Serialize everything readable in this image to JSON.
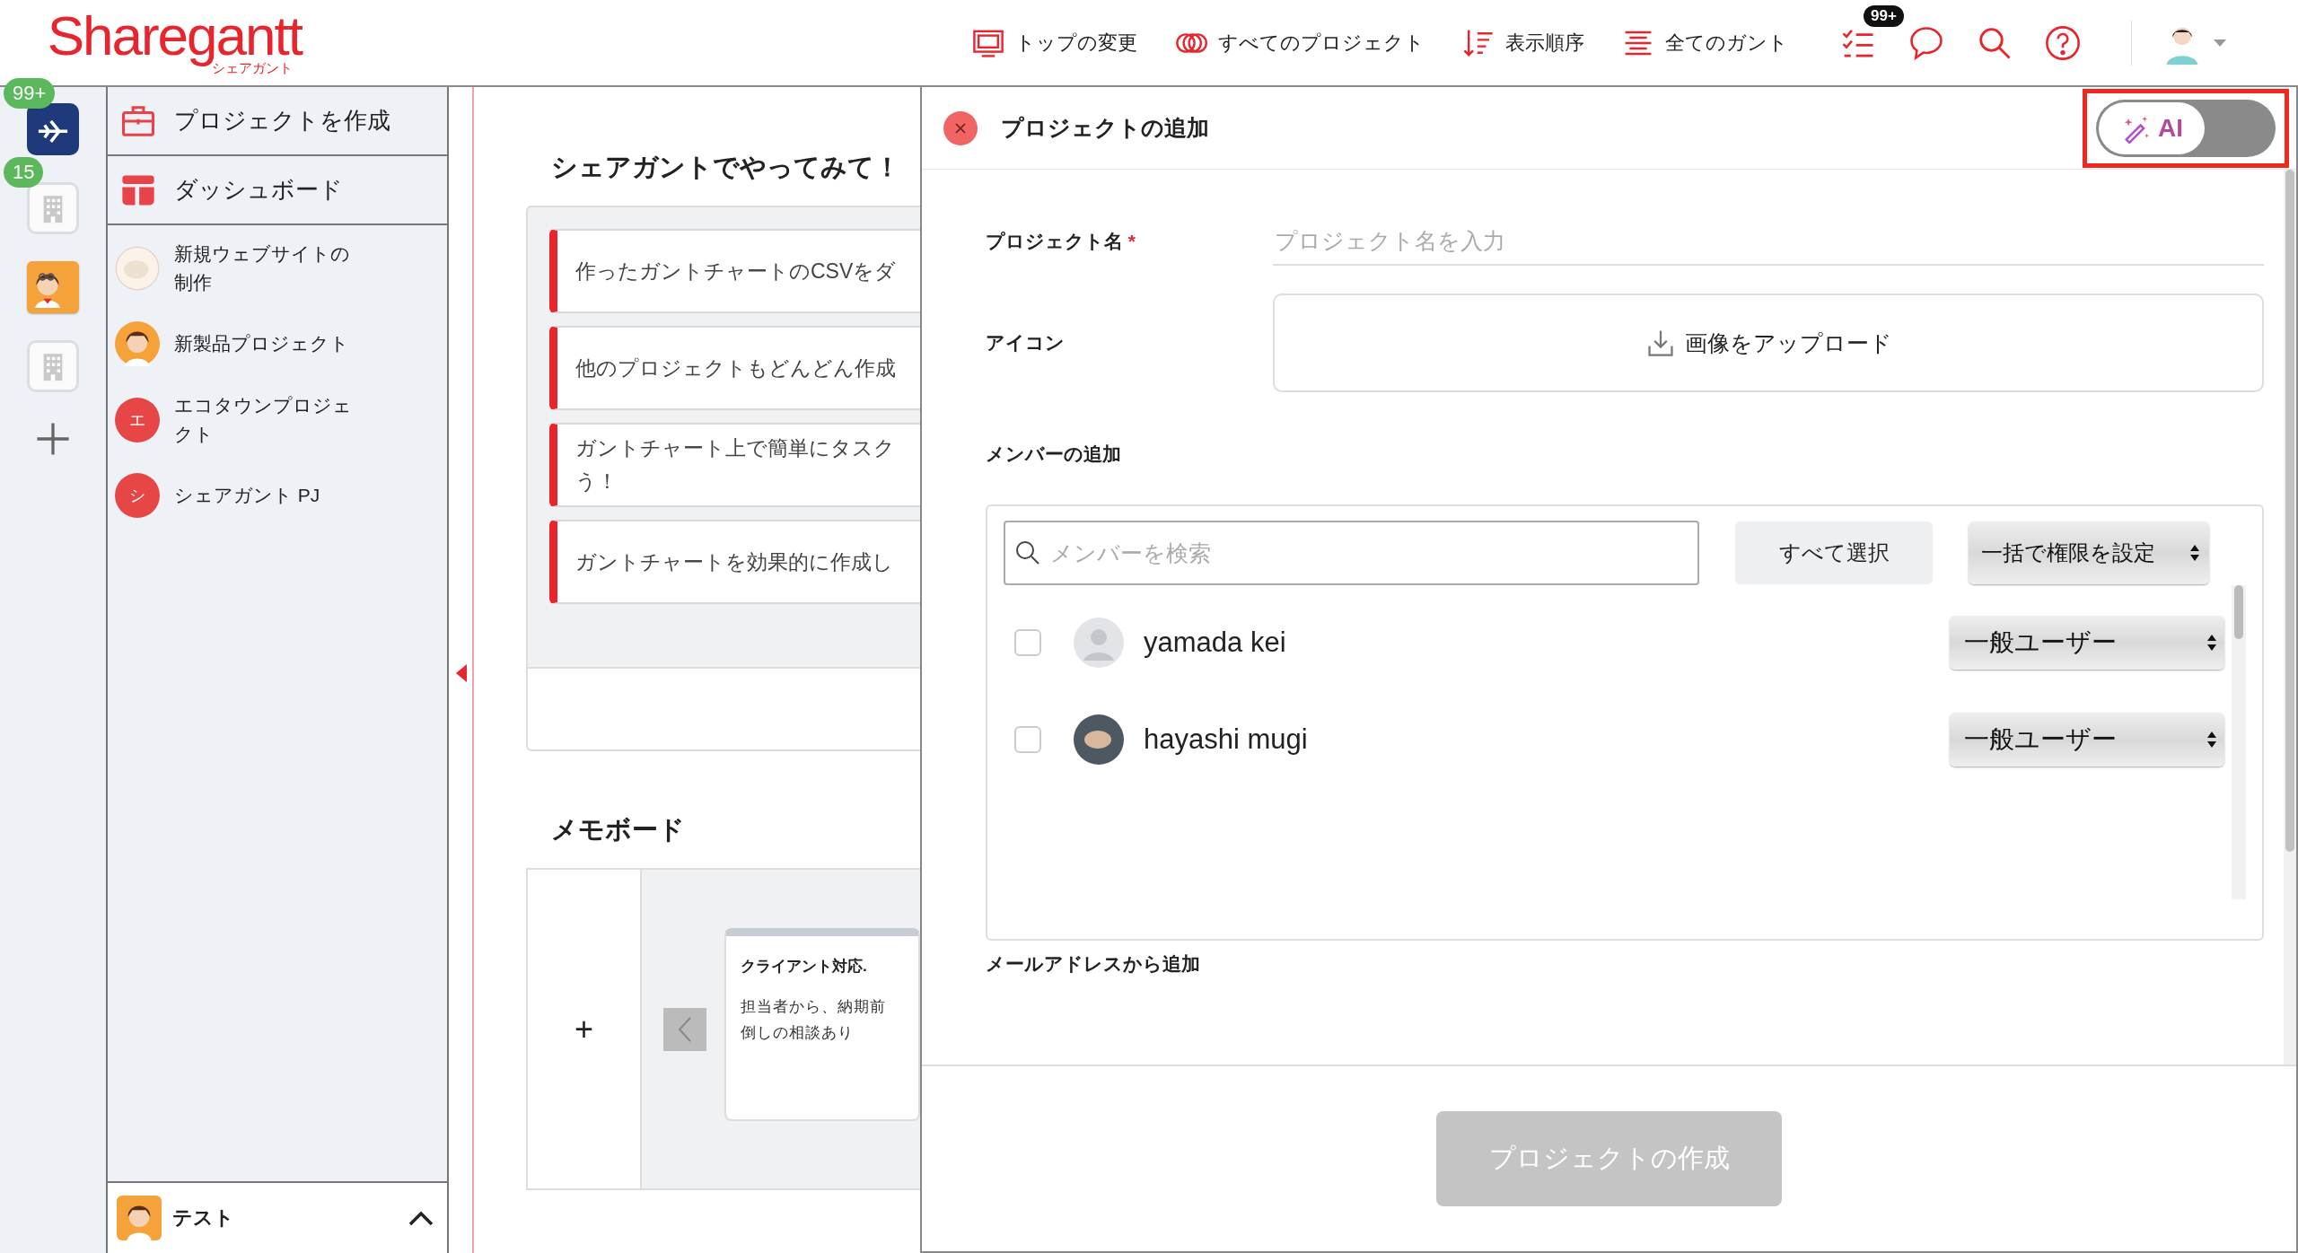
{
  "header": {
    "logo": "Sharegantt",
    "logo_sub": "シェアガント",
    "nav": [
      {
        "label": "トップの変更"
      },
      {
        "label": "すべてのプロジェクト"
      },
      {
        "label": "表示順序"
      },
      {
        "label": "全てのガント"
      }
    ],
    "task_badge": "99+"
  },
  "workspaces": [
    {
      "kind": "plane",
      "badge": "99+",
      "selected": false
    },
    {
      "kind": "building",
      "badge": "15",
      "selected": false
    },
    {
      "kind": "character",
      "selected": true
    },
    {
      "kind": "building",
      "selected": false
    }
  ],
  "sidebar": {
    "actions": [
      {
        "label": "プロジェクトを作成"
      },
      {
        "label": "ダッシュボード"
      }
    ],
    "projects": [
      {
        "name": "新規ウェブサイトの制作",
        "kind": "photo"
      },
      {
        "name": "新製品プロジェクト",
        "kind": "character"
      },
      {
        "name": "エコタウンプロジェクト",
        "kind": "letter",
        "letter": "エ"
      },
      {
        "name": "シェアガント PJ",
        "kind": "letter",
        "letter": "シ"
      }
    ],
    "footer": {
      "label": "テスト"
    }
  },
  "tips": {
    "title": "シェアガントでやってみて！",
    "items": [
      {
        "lines": [
          "作ったガントチャートのCSVをダ"
        ]
      },
      {
        "lines": [
          "他のプロジェクトもどんどん作成"
        ]
      },
      {
        "lines": [
          "ガントチャート上で簡単にタスク",
          "う！"
        ]
      },
      {
        "lines": [
          "ガントチャートを効果的に作成し"
        ]
      }
    ]
  },
  "memo_board": {
    "title": "メモボード",
    "add": "+",
    "cards": [
      {
        "title": "クライアント対応.",
        "body": "担当者から、納期前倒しの相談あり"
      }
    ]
  },
  "modal": {
    "title": "プロジェクトの追加",
    "ai_toggle": {
      "label": "AI",
      "on": false,
      "highlighted": true
    },
    "name_field": {
      "label": "プロジェクト名",
      "required_mark": "*",
      "placeholder": "プロジェクト名を入力"
    },
    "icon_field": {
      "label": "アイコン",
      "button": "画像をアップロード"
    },
    "members": {
      "label": "メンバーの追加",
      "search_placeholder": "メンバーを検索",
      "select_all": "すべて選択",
      "bulk_role": "一括で権限を設定",
      "rows": [
        {
          "name": "yamada kei",
          "kind": "default",
          "checked": false,
          "role": "一般ユーザー"
        },
        {
          "name": "hayashi mugi",
          "kind": "photo",
          "checked": false,
          "role": "一般ユーザー"
        }
      ]
    },
    "email_label": "メールアドレスから追加",
    "submit": {
      "label": "プロジェクトの作成",
      "disabled": true
    }
  }
}
